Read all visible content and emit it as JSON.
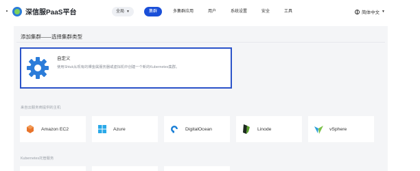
{
  "header": {
    "brand_name": "深信服PaaS平台",
    "scope_select": "全局",
    "nav_items": [
      "集群",
      "多集群应用",
      "用户",
      "系统设置",
      "安全",
      "工具"
    ],
    "active_nav_index": 0,
    "language": "简体中文"
  },
  "page": {
    "title": "添加集群——选择集群类型"
  },
  "custom_option": {
    "title": "自定义",
    "description": "使用Shtuk从现有的裸金属服务器或虚拟机中创建一个新的Kubernetes集群。",
    "icon": "gear-icon",
    "selected": true
  },
  "infra_section": {
    "label": "来自云服务商提供的主机",
    "providers": [
      {
        "label": "Amazon EC2",
        "icon": "aws-icon"
      },
      {
        "label": "Azure",
        "icon": "azure-icon"
      },
      {
        "label": "DigitalOcean",
        "icon": "digitalocean-icon"
      },
      {
        "label": "Linode",
        "icon": "linode-icon"
      },
      {
        "label": "vSphere",
        "icon": "vsphere-icon"
      }
    ]
  },
  "hosted_section": {
    "label": "Kubernetes托管服务"
  },
  "colors": {
    "accent": "#1a4fd8",
    "selected_border": "#2a52c9",
    "panel_bg": "#f4f5f7"
  }
}
